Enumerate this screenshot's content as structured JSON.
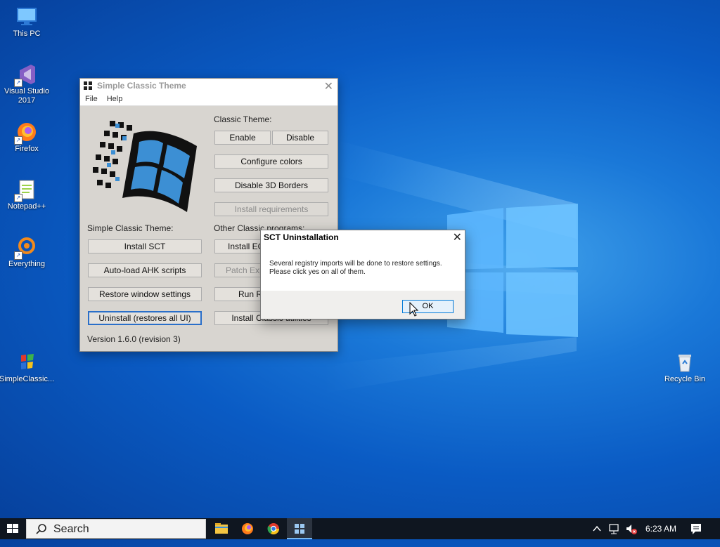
{
  "desktop": {
    "icons": [
      {
        "label": "This PC"
      },
      {
        "label": "Visual Studio 2017"
      },
      {
        "label": "Firefox"
      },
      {
        "label": "Notepad++"
      },
      {
        "label": "Everything"
      },
      {
        "label": "SimpleClassic..."
      },
      {
        "label": "Recycle Bin"
      }
    ]
  },
  "sct_window": {
    "title": "Simple Classic Theme",
    "menu": [
      "File",
      "Help"
    ],
    "classic_theme_label": "Classic Theme:",
    "enable": "Enable",
    "disable": "Disable",
    "configure_colors": "Configure colors",
    "disable_3d_borders": "Disable 3D Borders",
    "install_requirements": "Install requirements",
    "simple_classic_theme_label": "Simple Classic Theme:",
    "install_sct": "Install SCT",
    "autoload_ahk": "Auto-load AHK scripts",
    "restore_window_settings": "Restore window settings",
    "uninstall": "Uninstall (restores all UI)",
    "other_programs_label": "Other Classic programs:",
    "install_ec": "Install EC",
    "patch_expl": "Patch Expl",
    "run_r": "Run R",
    "install_classic_utilities": "Install Classic utilities",
    "version": "Version 1.6.0 (revision 3)"
  },
  "dialog": {
    "title": "SCT Uninstallation",
    "message_line1": "Several registry imports will be done to restore settings.",
    "message_line2": "Please click yes on all of them.",
    "ok": "OK"
  },
  "taskbar": {
    "search_placeholder": "Search",
    "time": "6:23 AM"
  },
  "colors": {
    "accent": "#0078d7",
    "desktop_blue": "#0a5bc4"
  }
}
